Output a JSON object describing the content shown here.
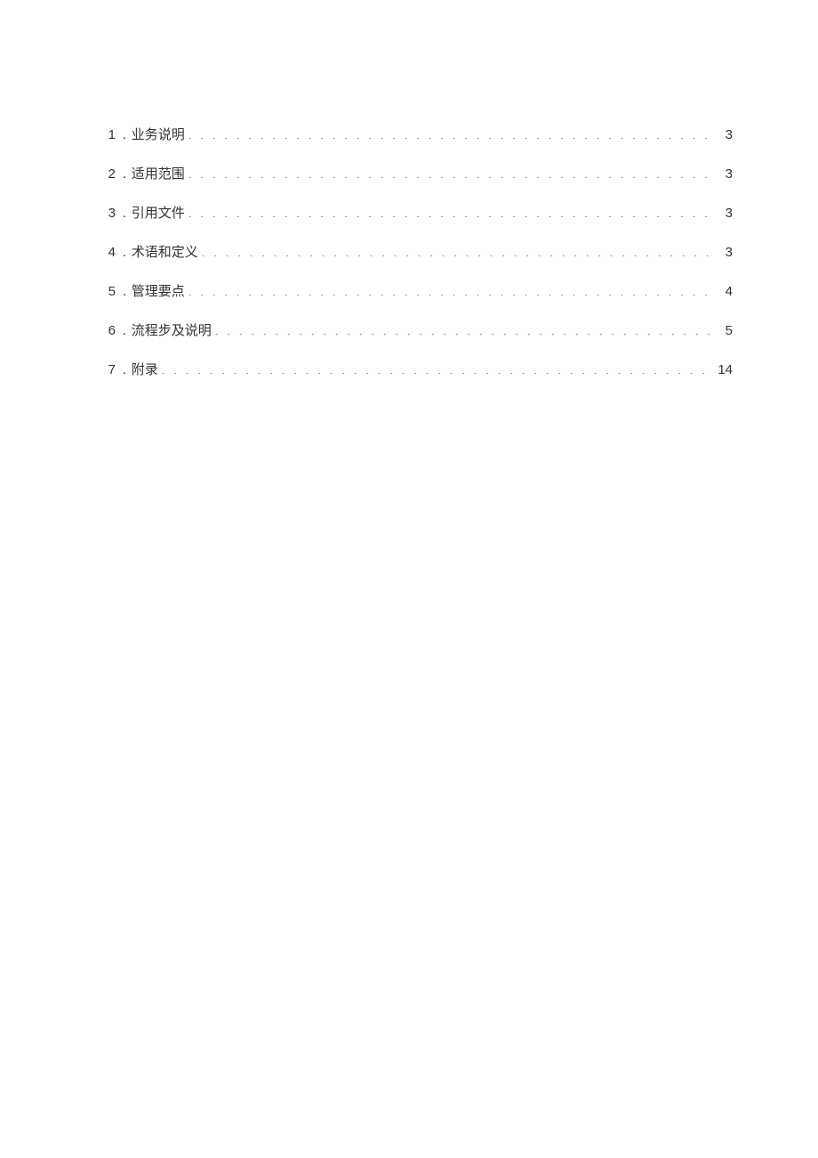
{
  "toc": {
    "entries": [
      {
        "num": "1",
        "sep": ".",
        "title": "业务说明",
        "page": "3"
      },
      {
        "num": "2",
        "sep": ".",
        "title": "适用范围",
        "page": "3"
      },
      {
        "num": "3",
        "sep": ".",
        "title": "引用文件",
        "page": "3"
      },
      {
        "num": "4",
        "sep": ".",
        "title": "术语和定义",
        "page": "3"
      },
      {
        "num": "5",
        "sep": ".",
        "title": "管理要点",
        "page": "4"
      },
      {
        "num": "6",
        "sep": ".",
        "title": "流程步及说明",
        "page": "5"
      },
      {
        "num": "7",
        "sep": ".",
        "title": "附录",
        "page": "14"
      }
    ]
  }
}
